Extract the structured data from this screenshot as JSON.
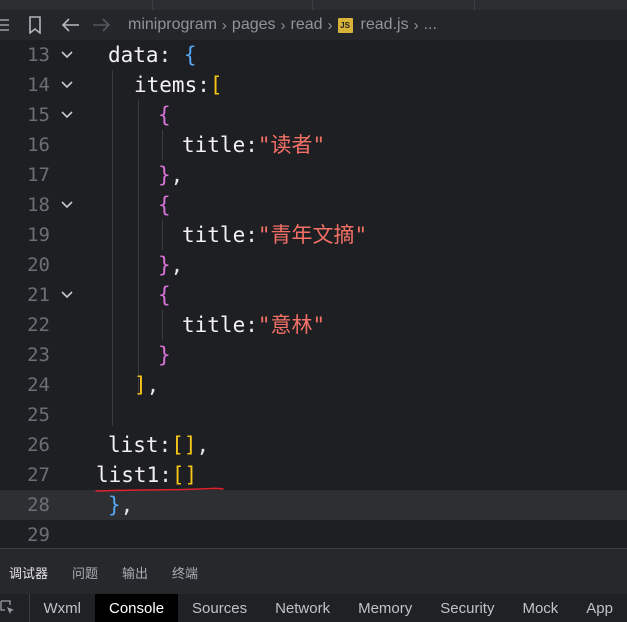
{
  "breadcrumb": {
    "items": [
      "miniprogram",
      "pages",
      "read"
    ],
    "file_badge": "JS",
    "file": "read.js",
    "overflow": "..."
  },
  "editor": {
    "lines": [
      {
        "num": "13",
        "fold": true
      },
      {
        "num": "14",
        "fold": true
      },
      {
        "num": "15",
        "fold": true
      },
      {
        "num": "16",
        "fold": false
      },
      {
        "num": "17",
        "fold": false
      },
      {
        "num": "18",
        "fold": true
      },
      {
        "num": "19",
        "fold": false
      },
      {
        "num": "20",
        "fold": false
      },
      {
        "num": "21",
        "fold": true
      },
      {
        "num": "22",
        "fold": false
      },
      {
        "num": "23",
        "fold": false
      },
      {
        "num": "24",
        "fold": false
      },
      {
        "num": "25",
        "fold": false
      },
      {
        "num": "26",
        "fold": false
      },
      {
        "num": "27",
        "fold": false
      },
      {
        "num": "28",
        "fold": false
      },
      {
        "num": "29",
        "fold": false
      }
    ],
    "code": {
      "l13_key": "data",
      "l13_colon": ": ",
      "l13_brace": "{",
      "l14_key": "items",
      "l14_colon": ":",
      "l14_bracket": "[",
      "l15_brace": "{",
      "l16_key": "title",
      "l16_colon": ":",
      "l16_value": "\"读者\"",
      "l17_brace": "}",
      "l17_comma": ",",
      "l18_brace": "{",
      "l19_key": "title",
      "l19_colon": ":",
      "l19_value": "\"青年文摘\"",
      "l20_brace": "}",
      "l20_comma": ",",
      "l21_brace": "{",
      "l22_key": "title",
      "l22_colon": ":",
      "l22_value": "\"意林\"",
      "l23_brace": "}",
      "l24_bracket": "]",
      "l24_comma": ",",
      "l26_key": "list",
      "l26_colon": ":",
      "l26_brackets": "[]",
      "l26_comma": ",",
      "l27_key": "list1",
      "l27_colon": ":",
      "l27_brackets": "[]",
      "l28_brace": "}",
      "l28_comma": ","
    }
  },
  "panel_tabs": [
    "调试器",
    "问题",
    "输出",
    "终端"
  ],
  "devtools_tabs": [
    "Wxml",
    "Console",
    "Sources",
    "Network",
    "Memory",
    "Security",
    "Mock",
    "App"
  ],
  "devtools_active": "Console",
  "colors": {
    "string": "#f47067",
    "bracket_level1": "#f5c518",
    "bracket_level2": "#d973d9",
    "bracket_level3": "#56a8f5",
    "squiggle": "#e0202a"
  }
}
